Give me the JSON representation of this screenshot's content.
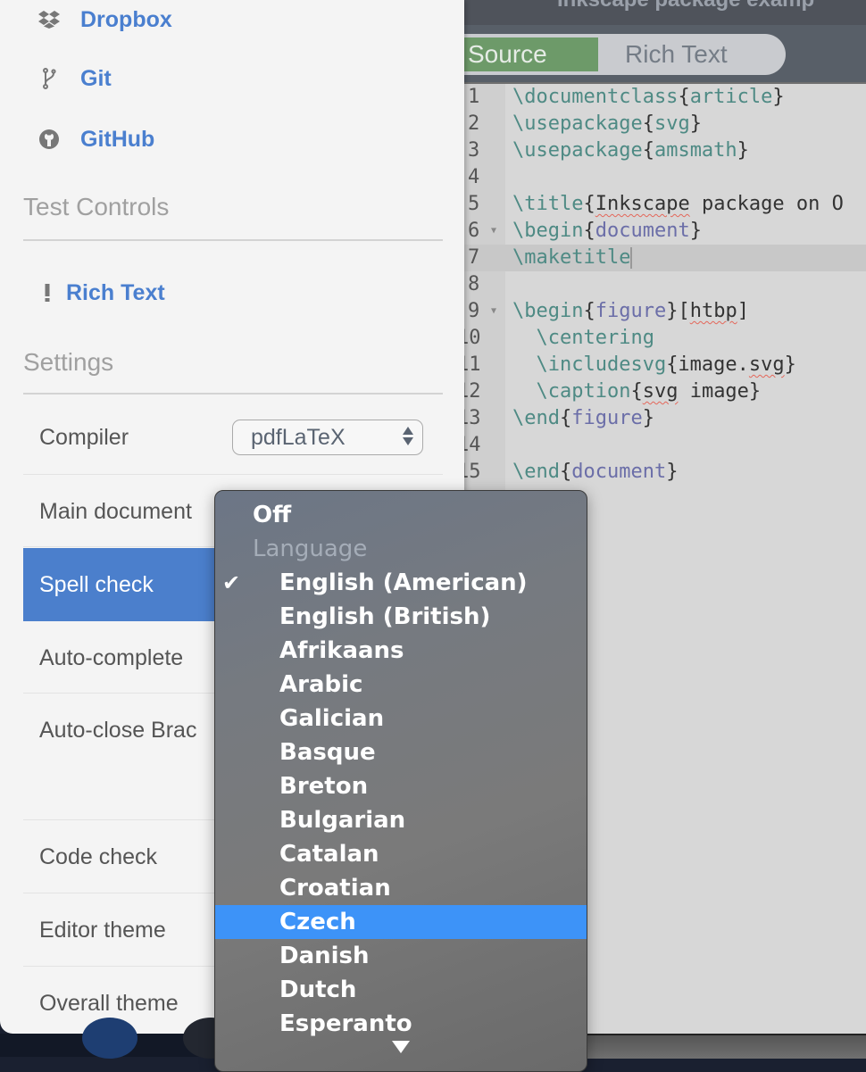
{
  "editor": {
    "title": "Inkscape package examp",
    "mode_toggle": {
      "source_label": "Source",
      "rich_text_label": "Rich Text",
      "active": "Source"
    },
    "active_line": 7,
    "lines": [
      {
        "n": "1",
        "code": [
          {
            "t": "\\documentclass",
            "c": "cmd"
          },
          {
            "t": "{",
            "c": "brace"
          },
          {
            "t": "article",
            "c": "cmd"
          },
          {
            "t": "}",
            "c": "brace"
          }
        ]
      },
      {
        "n": "2",
        "code": [
          {
            "t": "\\usepackage",
            "c": "cmd"
          },
          {
            "t": "{",
            "c": "brace"
          },
          {
            "t": "svg",
            "c": "cmd"
          },
          {
            "t": "}",
            "c": "brace"
          }
        ]
      },
      {
        "n": "3",
        "code": [
          {
            "t": "\\usepackage",
            "c": "cmd"
          },
          {
            "t": "{",
            "c": "brace"
          },
          {
            "t": "amsmath",
            "c": "cmd"
          },
          {
            "t": "}",
            "c": "brace"
          }
        ]
      },
      {
        "n": "4",
        "code": []
      },
      {
        "n": "5",
        "code": [
          {
            "t": "\\title",
            "c": "cmd"
          },
          {
            "t": "{",
            "c": "brace"
          },
          {
            "t": "Inkscape",
            "c": "misspell"
          },
          {
            "t": " package on O",
            "c": ""
          }
        ]
      },
      {
        "n": "6",
        "fold": true,
        "code": [
          {
            "t": "\\begin",
            "c": "cmd"
          },
          {
            "t": "{",
            "c": "brace"
          },
          {
            "t": "document",
            "c": "arg"
          },
          {
            "t": "}",
            "c": "brace"
          }
        ]
      },
      {
        "n": "7",
        "code": [
          {
            "t": "\\maketitle",
            "c": "cmd"
          }
        ],
        "cursor": true
      },
      {
        "n": "8",
        "code": []
      },
      {
        "n": "9",
        "fold": true,
        "code": [
          {
            "t": "\\begin",
            "c": "cmd"
          },
          {
            "t": "{",
            "c": "brace"
          },
          {
            "t": "figure",
            "c": "arg"
          },
          {
            "t": "}[",
            "c": "brace"
          },
          {
            "t": "htbp",
            "c": "misspell"
          },
          {
            "t": "]",
            "c": "brace"
          }
        ]
      },
      {
        "n": "10",
        "code": [
          {
            "t": "  \\centering",
            "c": "cmd"
          }
        ]
      },
      {
        "n": "11",
        "code": [
          {
            "t": "  \\includesvg",
            "c": "cmd"
          },
          {
            "t": "{image.",
            "c": "brace"
          },
          {
            "t": "svg",
            "c": "misspell"
          },
          {
            "t": "}",
            "c": "brace"
          }
        ]
      },
      {
        "n": "12",
        "code": [
          {
            "t": "  \\caption",
            "c": "cmd"
          },
          {
            "t": "{",
            "c": "brace"
          },
          {
            "t": "svg",
            "c": "misspell"
          },
          {
            "t": " image}",
            "c": "brace"
          }
        ]
      },
      {
        "n": "13",
        "code": [
          {
            "t": "\\end",
            "c": "cmd"
          },
          {
            "t": "{",
            "c": "brace"
          },
          {
            "t": "figure",
            "c": "arg"
          },
          {
            "t": "}",
            "c": "brace"
          }
        ]
      },
      {
        "n": "14",
        "code": []
      },
      {
        "n": "15",
        "code": [
          {
            "t": "\\end",
            "c": "cmd"
          },
          {
            "t": "{",
            "c": "brace"
          },
          {
            "t": "document",
            "c": "arg"
          },
          {
            "t": "}",
            "c": "brace"
          }
        ]
      }
    ]
  },
  "panel": {
    "sync_links": [
      {
        "label": "Dropbox",
        "icon": "dropbox-icon"
      },
      {
        "label": "Git",
        "icon": "git-branch-icon"
      },
      {
        "label": "GitHub",
        "icon": "github-icon"
      }
    ],
    "test_controls": {
      "title": "Test Controls",
      "items": [
        {
          "label": "Rich Text",
          "icon": "exclamation-icon"
        }
      ]
    },
    "settings": {
      "title": "Settings",
      "rows": [
        {
          "label": "Compiler",
          "value": "pdfLaTeX"
        },
        {
          "label": "Main document"
        },
        {
          "label": "Spell check",
          "selected": true
        },
        {
          "label": "Auto-complete"
        },
        {
          "label": "Auto-close Brac"
        },
        {
          "label": "Code check"
        },
        {
          "label": "Editor theme"
        },
        {
          "label": "Overall theme"
        }
      ]
    }
  },
  "spell_menu": {
    "off_label": "Off",
    "group_header": "Language",
    "checked": "English (American)",
    "highlighted": "Czech",
    "languages": [
      "English (American)",
      "English (British)",
      "Afrikaans",
      "Arabic",
      "Galician",
      "Basque",
      "Breton",
      "Bulgarian",
      "Catalan",
      "Croatian",
      "Czech",
      "Danish",
      "Dutch",
      "Esperanto"
    ]
  },
  "colors": {
    "link_blue": "#4a7fcf",
    "selected_row": "#4b7fcc",
    "source_toggle_green": "#6d9a69",
    "menu_highlight": "#3d93f8"
  }
}
